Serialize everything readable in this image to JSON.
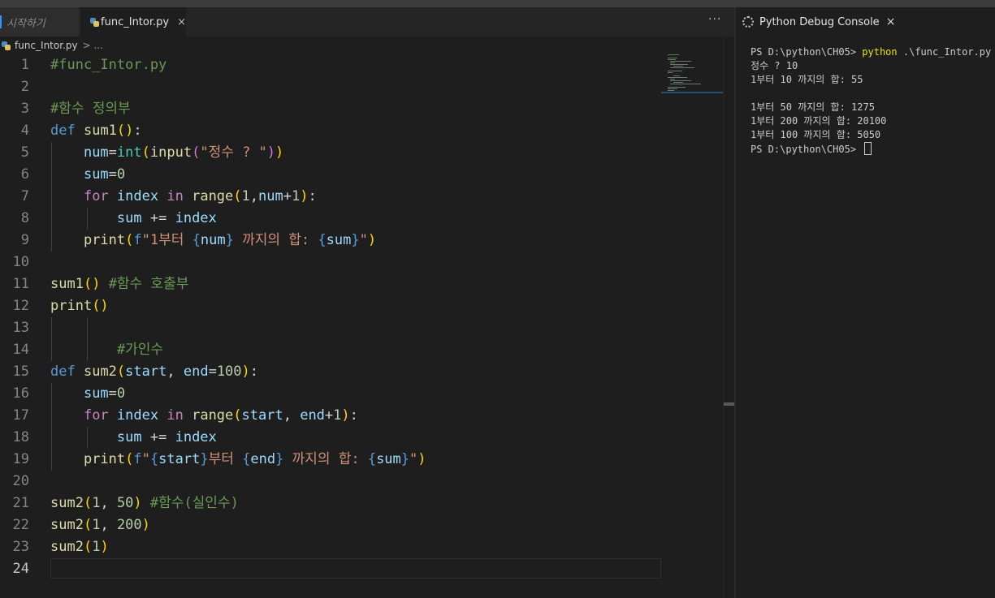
{
  "tabs": {
    "start_tab": "시작하기",
    "file_tab": "func_Intor.py",
    "close_glyph": "×",
    "more_glyph": "···"
  },
  "breadcrumb": {
    "file": "func_Intor.py",
    "sep": "> ..."
  },
  "editor": {
    "line_numbers": [
      "1",
      "2",
      "3",
      "4",
      "5",
      "6",
      "7",
      "8",
      "9",
      "10",
      "11",
      "12",
      "13",
      "14",
      "15",
      "16",
      "17",
      "18",
      "19",
      "20",
      "21",
      "22",
      "23",
      "24"
    ],
    "code": {
      "l1": "#func_Intor.py",
      "l3": "#함수 정의부",
      "l4_def": "def",
      "l4_name": "sum1",
      "l4_paren": "()",
      "l4_colon": ":",
      "l5_var": "num",
      "l5_eq": "=",
      "l5_int": "int",
      "l5_p1": "(",
      "l5_input": "input",
      "l5_p2": "(",
      "l5_str": "\"정수 ? \"",
      "l5_p2c": ")",
      "l5_p1c": ")",
      "l6_var": "sum",
      "l6_eq": "=",
      "l6_num": "0",
      "l7_for": "for",
      "l7_var": "index",
      "l7_in": "in",
      "l7_range": "range",
      "l7_po": "(",
      "l7_one": "1",
      "l7_comma": ",",
      "l7_num": "num",
      "l7_plus": "+",
      "l7_one2": "1",
      "l7_pc": ")",
      "l7_colon": ":",
      "l8_sum": "sum",
      "l8_op": "+=",
      "l8_index": "index",
      "l9_print": "print",
      "l9_po": "(",
      "l9_f": "f",
      "l9_s1": "\"1부터 ",
      "l9_b1": "{",
      "l9_num": "num",
      "l9_b1c": "}",
      "l9_s2": " 까지의 합: ",
      "l9_b2": "{",
      "l9_sum": "sum",
      "l9_b2c": "}",
      "l9_s3": "\"",
      "l9_pc": ")",
      "l11_call": "sum1",
      "l11_paren": "()",
      "l11_cm": "#함수 호출부",
      "l12_print": "print",
      "l12_paren": "()",
      "l14_cm": "#가인수",
      "l15_def": "def",
      "l15_name": "sum2",
      "l15_po": "(",
      "l15_start": "start",
      "l15_comma": ", ",
      "l15_end": "end",
      "l15_eq": "=",
      "l15_num": "100",
      "l15_pc": ")",
      "l15_colon": ":",
      "l16_var": "sum",
      "l16_eq": "=",
      "l16_num": "0",
      "l17_for": "for",
      "l17_var": "index",
      "l17_in": "in",
      "l17_range": "range",
      "l17_po": "(",
      "l17_start": "start",
      "l17_comma": ", ",
      "l17_end": "end",
      "l17_plus": "+",
      "l17_one": "1",
      "l17_pc": ")",
      "l17_colon": ":",
      "l18_sum": "sum",
      "l18_op": "+=",
      "l18_index": "index",
      "l19_print": "print",
      "l19_po": "(",
      "l19_f": "f",
      "l19_q": "\"",
      "l19_b1": "{",
      "l19_start": "start",
      "l19_b1c": "}",
      "l19_s1": "부터 ",
      "l19_b2": "{",
      "l19_end": "end",
      "l19_b2c": "}",
      "l19_s2": " 까지의 합: ",
      "l19_b3": "{",
      "l19_sum": "sum",
      "l19_b3c": "}",
      "l19_q2": "\"",
      "l19_pc": ")",
      "l21_call": "sum2",
      "l21_po": "(",
      "l21_a": "1",
      "l21_comma": ", ",
      "l21_b": "50",
      "l21_pc": ")",
      "l21_cm": "#함수(실인수)",
      "l22_call": "sum2",
      "l22_po": "(",
      "l22_a": "1",
      "l22_comma": ", ",
      "l22_b": "200",
      "l22_pc": ")",
      "l23_call": "sum2",
      "l23_po": "(",
      "l23_a": "1",
      "l23_pc": ")"
    }
  },
  "panel": {
    "title": "Python Debug Console",
    "close_glyph": "×",
    "terminal": {
      "prompt1": "PS D:\\python\\CH05> ",
      "cmd_python": "python",
      "cmd_arg": " .\\func_Intor.py",
      "line2": "정수 ? 10",
      "line3": "1부터 10 까지의 합: 55",
      "line4": "",
      "line5": "1부터 50 까지의 합: 1275",
      "line6": "1부터 200 까지의 합: 20100",
      "line7": "1부터 100 까지의 합: 5050",
      "prompt2": "PS D:\\python\\CH05> "
    }
  },
  "colors": {
    "background": "#1e1e1e",
    "comment": "#6a9955",
    "keyword": "#c586c0",
    "function": "#dcdcaa",
    "variable": "#9cdcfe",
    "string": "#ce9178",
    "number": "#b5cea8",
    "bracket_gold": "#ffd700",
    "bracket_pink": "#da70d6",
    "bracket_blue": "#179fff"
  }
}
